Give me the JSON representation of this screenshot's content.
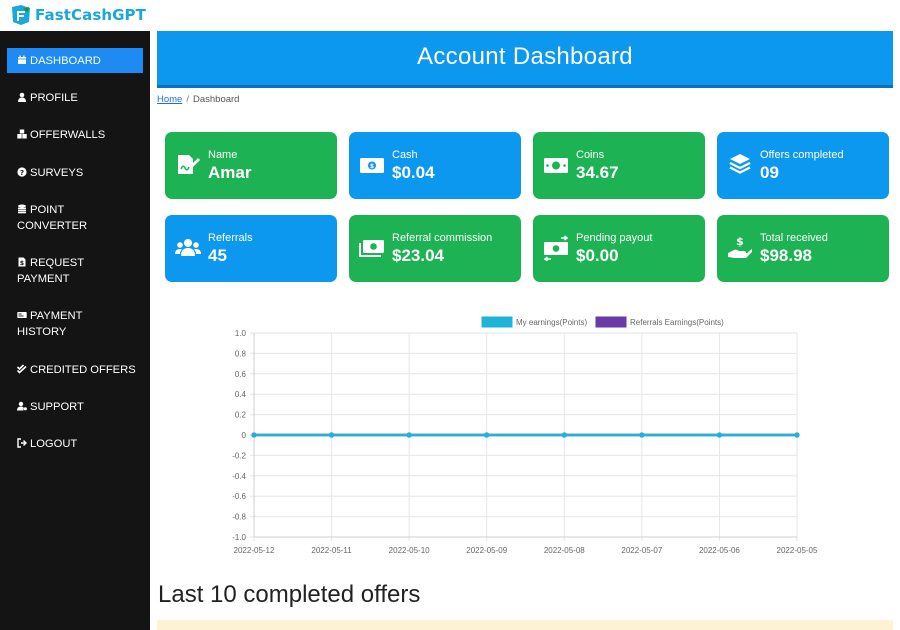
{
  "brand": {
    "name": "FastCashGPT",
    "color": "#1aa7d9"
  },
  "sidebar": {
    "items": [
      {
        "label": "DASHBOARD",
        "icon": "calendar-icon",
        "active": true
      },
      {
        "label": "PROFILE",
        "icon": "user-icon"
      },
      {
        "label": "OFFERWALLS",
        "icon": "cubes-icon"
      },
      {
        "label": "SURVEYS",
        "icon": "question-circle-icon"
      },
      {
        "label": "POINT",
        "label2": "CONVERTER",
        "icon": "coins-icon"
      },
      {
        "label": "REQUEST",
        "label2": "PAYMENT",
        "icon": "file-invoice-icon"
      },
      {
        "label": "PAYMENT",
        "label2": "HISTORY",
        "icon": "money-check-icon"
      },
      {
        "label": "CREDITED OFFERS",
        "icon": "check-double-icon"
      },
      {
        "label": "SUPPORT",
        "icon": "user-gear-icon"
      },
      {
        "label": "LOGOUT",
        "icon": "sign-out-icon"
      }
    ]
  },
  "header": {
    "title": "Account Dashboard"
  },
  "breadcrumb": {
    "home": "Home",
    "current": "Dashboard"
  },
  "cards": [
    {
      "label": "Name",
      "value": "Amar",
      "color": "green",
      "icon": "signature-icon"
    },
    {
      "label": "Cash",
      "value": "$0.04",
      "color": "blue",
      "icon": "money-bill-icon"
    },
    {
      "label": "Coins",
      "value": "34.67",
      "color": "green",
      "icon": "money-bill-icon"
    },
    {
      "label": "Offers completed",
      "value": "09",
      "color": "blue",
      "icon": "layers-icon"
    },
    {
      "label": "Referrals",
      "value": "45",
      "color": "blue",
      "icon": "users-icon"
    },
    {
      "label": "Referral commission",
      "value": "$23.04",
      "color": "green",
      "icon": "money-bills-icon"
    },
    {
      "label": "Pending payout",
      "value": "$0.00",
      "color": "green",
      "icon": "money-transfer-icon"
    },
    {
      "label": "Total received",
      "value": "$98.98",
      "color": "green",
      "icon": "hand-dollar-icon"
    }
  ],
  "chart_data": {
    "type": "line",
    "x": [
      "2022-05-12",
      "2022-05-11",
      "2022-05-10",
      "2022-05-09",
      "2022-05-08",
      "2022-05-07",
      "2022-05-06",
      "2022-05-05"
    ],
    "series": [
      {
        "name": "My earnings(Points)",
        "values": [
          0,
          0,
          0,
          0,
          0,
          0,
          0,
          0
        ],
        "color": "#1fb3d8"
      },
      {
        "name": "Referrals Earnings(Points)",
        "values": [
          0,
          0,
          0,
          0,
          0,
          0,
          0,
          0
        ],
        "color": "#6a3aa6"
      }
    ],
    "ylim": [
      -1.0,
      1.0
    ],
    "yticks": [
      "1.0",
      "0.8",
      "0.6",
      "0.4",
      "0.2",
      "0",
      "-0.2",
      "-0.4",
      "-0.6",
      "-0.8",
      "-1.0"
    ],
    "grid": true,
    "legend": "top-center"
  },
  "section": {
    "title": "Last 10 completed offers"
  }
}
